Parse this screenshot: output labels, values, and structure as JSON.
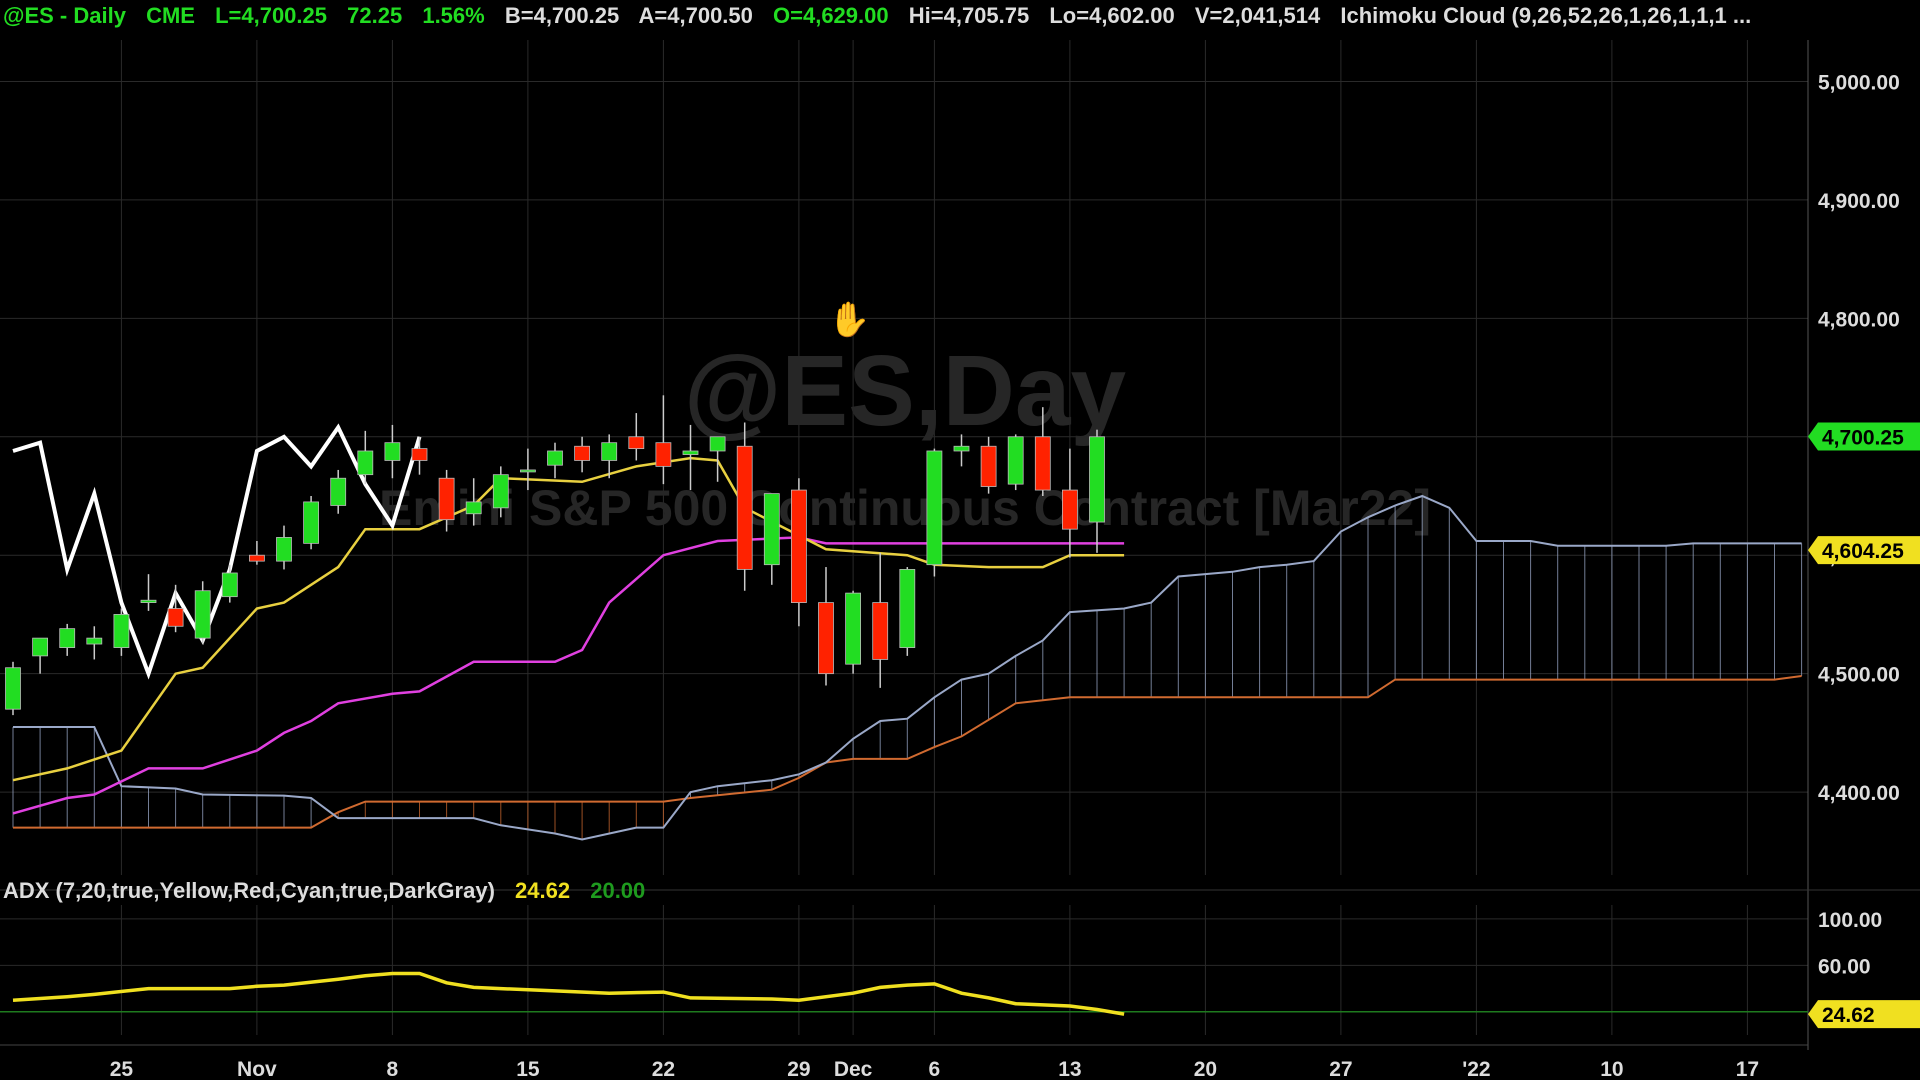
{
  "header": {
    "symbol": "@ES - Daily",
    "exchange": "CME",
    "last": "L=4,700.25",
    "change": "72.25",
    "change_pct": "1.56%",
    "bid": "B=4,700.25",
    "ask": "A=4,700.50",
    "open": "O=4,629.00",
    "high": "Hi=4,705.75",
    "low": "Lo=4,602.00",
    "volume": "V=2,041,514",
    "indicator": "Ichimoku Cloud (9,26,52,26,1,26,1,1,1 ..."
  },
  "watermark": {
    "line1": "@ES,Day",
    "line2": "Emini S&P 500 Continuous Contract [Mar22]"
  },
  "adx_header": {
    "label": "ADX (7,20,true,Yellow,Red,Cyan,true,DarkGray)",
    "value": "24.62",
    "threshold": "20.00"
  },
  "colors": {
    "up": "#22dd22",
    "down": "#ff2200",
    "tenkan": "#e8d040",
    "kijun": "#e040e0",
    "chikou": "#ffffff",
    "spanA": "#9aa8c8",
    "spanB": "#d06a30",
    "adx": "#f0e020",
    "grid": "#2a2a2a",
    "green_text": "#22dd22",
    "yellow": "#f0e020"
  },
  "chart_data": {
    "type": "candlestick",
    "y_axis": {
      "min": 4330,
      "max": 5035,
      "ticks": [
        4400,
        4500,
        4600,
        4700,
        4800,
        4900,
        5000
      ],
      "tick_labels": [
        "4,400.00",
        "4,500.00",
        "4,600.00",
        "4,700.00",
        "4,800.00",
        "4,900.00",
        "5,000.00"
      ]
    },
    "price_tags": [
      {
        "label": "4,700.25",
        "value": 4700.25,
        "color": "#22dd22"
      },
      {
        "label": "4,604.25",
        "value": 4604.25,
        "color": "#f0e020"
      }
    ],
    "x_axis": {
      "n": 67,
      "labels": [
        {
          "i": 4,
          "text": "25"
        },
        {
          "i": 9,
          "text": "Nov"
        },
        {
          "i": 14,
          "text": "8"
        },
        {
          "i": 19,
          "text": "15"
        },
        {
          "i": 24,
          "text": "22"
        },
        {
          "i": 29,
          "text": "29"
        },
        {
          "i": 31,
          "text": "Dec"
        },
        {
          "i": 34,
          "text": "6"
        },
        {
          "i": 39,
          "text": "13"
        },
        {
          "i": 44,
          "text": "20"
        },
        {
          "i": 49,
          "text": "27"
        },
        {
          "i": 54,
          "text": "'22"
        },
        {
          "i": 59,
          "text": "10"
        },
        {
          "i": 64,
          "text": "17"
        }
      ]
    },
    "candles": [
      {
        "o": 4470,
        "h": 4510,
        "l": 4465,
        "c": 4505
      },
      {
        "o": 4515,
        "h": 4530,
        "l": 4500,
        "c": 4530
      },
      {
        "o": 4522,
        "h": 4542,
        "l": 4515,
        "c": 4538
      },
      {
        "o": 4525,
        "h": 4540,
        "l": 4512,
        "c": 4530
      },
      {
        "o": 4522,
        "h": 4555,
        "l": 4515,
        "c": 4550
      },
      {
        "o": 4560,
        "h": 4584,
        "l": 4553,
        "c": 4562
      },
      {
        "o": 4555,
        "h": 4575,
        "l": 4535,
        "c": 4540
      },
      {
        "o": 4530,
        "h": 4578,
        "l": 4525,
        "c": 4570
      },
      {
        "o": 4565,
        "h": 4592,
        "l": 4560,
        "c": 4585
      },
      {
        "o": 4600,
        "h": 4612,
        "l": 4592,
        "c": 4595
      },
      {
        "o": 4595,
        "h": 4625,
        "l": 4588,
        "c": 4615
      },
      {
        "o": 4610,
        "h": 4650,
        "l": 4605,
        "c": 4645
      },
      {
        "o": 4642,
        "h": 4672,
        "l": 4635,
        "c": 4665
      },
      {
        "o": 4668,
        "h": 4705,
        "l": 4660,
        "c": 4688
      },
      {
        "o": 4680,
        "h": 4710,
        "l": 4665,
        "c": 4695
      },
      {
        "o": 4690,
        "h": 4700,
        "l": 4668,
        "c": 4680
      },
      {
        "o": 4665,
        "h": 4672,
        "l": 4620,
        "c": 4630
      },
      {
        "o": 4635,
        "h": 4665,
        "l": 4625,
        "c": 4645
      },
      {
        "o": 4640,
        "h": 4675,
        "l": 4632,
        "c": 4668
      },
      {
        "o": 4672,
        "h": 4690,
        "l": 4655,
        "c": 4672
      },
      {
        "o": 4676,
        "h": 4695,
        "l": 4665,
        "c": 4688
      },
      {
        "o": 4692,
        "h": 4700,
        "l": 4670,
        "c": 4680
      },
      {
        "o": 4680,
        "h": 4702,
        "l": 4665,
        "c": 4695
      },
      {
        "o": 4700,
        "h": 4720,
        "l": 4680,
        "c": 4690
      },
      {
        "o": 4695,
        "h": 4735,
        "l": 4660,
        "c": 4675
      },
      {
        "o": 4685,
        "h": 4710,
        "l": 4655,
        "c": 4688
      },
      {
        "o": 4688,
        "h": 4700,
        "l": 4662,
        "c": 4700
      },
      {
        "o": 4692,
        "h": 4712,
        "l": 4570,
        "c": 4588
      },
      {
        "o": 4592,
        "h": 4652,
        "l": 4575,
        "c": 4652
      },
      {
        "o": 4655,
        "h": 4665,
        "l": 4540,
        "c": 4560
      },
      {
        "o": 4560,
        "h": 4590,
        "l": 4490,
        "c": 4500
      },
      {
        "o": 4508,
        "h": 4570,
        "l": 4500,
        "c": 4568
      },
      {
        "o": 4560,
        "h": 4602,
        "l": 4488,
        "c": 4512
      },
      {
        "o": 4522,
        "h": 4590,
        "l": 4515,
        "c": 4588
      },
      {
        "o": 4592,
        "h": 4690,
        "l": 4582,
        "c": 4688
      },
      {
        "o": 4688,
        "h": 4702,
        "l": 4675,
        "c": 4692
      },
      {
        "o": 4692,
        "h": 4700,
        "l": 4652,
        "c": 4658
      },
      {
        "o": 4660,
        "h": 4702,
        "l": 4655,
        "c": 4700
      },
      {
        "o": 4700,
        "h": 4725,
        "l": 4650,
        "c": 4655
      },
      {
        "o": 4655,
        "h": 4690,
        "l": 4598,
        "c": 4622
      },
      {
        "o": 4628,
        "h": 4706,
        "l": 4602,
        "c": 4700
      }
    ],
    "tenkan": [
      [
        0,
        4410
      ],
      [
        2,
        4420
      ],
      [
        4,
        4435
      ],
      [
        6,
        4500
      ],
      [
        7,
        4505
      ],
      [
        9,
        4555
      ],
      [
        10,
        4560
      ],
      [
        11,
        4575
      ],
      [
        12,
        4590
      ],
      [
        13,
        4622
      ],
      [
        15,
        4622
      ],
      [
        17,
        4642
      ],
      [
        18,
        4665
      ],
      [
        21,
        4662
      ],
      [
        23,
        4675
      ],
      [
        25,
        4682
      ],
      [
        26,
        4680
      ],
      [
        27,
        4640
      ],
      [
        30,
        4605
      ],
      [
        33,
        4600
      ],
      [
        34,
        4592
      ],
      [
        36,
        4590
      ],
      [
        38,
        4590
      ],
      [
        39,
        4600
      ],
      [
        41,
        4600
      ]
    ],
    "kijun": [
      [
        0,
        4382
      ],
      [
        2,
        4395
      ],
      [
        3,
        4398
      ],
      [
        5,
        4420
      ],
      [
        7,
        4420
      ],
      [
        9,
        4435
      ],
      [
        10,
        4450
      ],
      [
        11,
        4460
      ],
      [
        12,
        4475
      ],
      [
        14,
        4483
      ],
      [
        15,
        4485
      ],
      [
        17,
        4510
      ],
      [
        20,
        4510
      ],
      [
        21,
        4520
      ],
      [
        22,
        4560
      ],
      [
        23,
        4580
      ],
      [
        24,
        4600
      ],
      [
        26,
        4612
      ],
      [
        29,
        4615
      ],
      [
        30,
        4610
      ],
      [
        41,
        4610
      ]
    ],
    "chikou": [
      [
        0,
        4688
      ],
      [
        1,
        4695
      ],
      [
        2,
        4588
      ],
      [
        3,
        4652
      ],
      [
        4,
        4560
      ],
      [
        5,
        4500
      ],
      [
        6,
        4568
      ],
      [
        7,
        4528
      ],
      [
        8,
        4588
      ],
      [
        9,
        4688
      ],
      [
        10,
        4700
      ],
      [
        11,
        4675
      ],
      [
        12,
        4708
      ],
      [
        13,
        4660
      ],
      [
        14,
        4625
      ],
      [
        15,
        4700
      ]
    ],
    "span_a": [
      [
        0,
        4455
      ],
      [
        3,
        4455
      ],
      [
        4,
        4405
      ],
      [
        6,
        4403
      ],
      [
        7,
        4398
      ],
      [
        10,
        4397
      ],
      [
        11,
        4395
      ],
      [
        12,
        4378
      ],
      [
        17,
        4378
      ],
      [
        18,
        4372
      ],
      [
        20,
        4365
      ],
      [
        21,
        4360
      ],
      [
        23,
        4370
      ],
      [
        24,
        4370
      ],
      [
        25,
        4400
      ],
      [
        26,
        4405
      ],
      [
        28,
        4410
      ],
      [
        29,
        4415
      ],
      [
        30,
        4425
      ],
      [
        31,
        4445
      ],
      [
        32,
        4460
      ],
      [
        33,
        4462
      ],
      [
        34,
        4480
      ],
      [
        35,
        4495
      ],
      [
        36,
        4500
      ],
      [
        37,
        4515
      ],
      [
        38,
        4528
      ],
      [
        39,
        4552
      ],
      [
        41,
        4555
      ],
      [
        42,
        4560
      ],
      [
        43,
        4582
      ],
      [
        45,
        4586
      ],
      [
        46,
        4590
      ],
      [
        47,
        4592
      ],
      [
        48,
        4595
      ],
      [
        49,
        4620
      ],
      [
        50,
        4632
      ],
      [
        51,
        4642
      ],
      [
        52,
        4650
      ],
      [
        53,
        4640
      ],
      [
        54,
        4612
      ],
      [
        56,
        4612
      ],
      [
        57,
        4608
      ],
      [
        61,
        4608
      ],
      [
        62,
        4610
      ],
      [
        66,
        4610
      ]
    ],
    "span_b": [
      [
        0,
        4370
      ],
      [
        11,
        4370
      ],
      [
        12,
        4383
      ],
      [
        13,
        4392
      ],
      [
        24,
        4392
      ],
      [
        25,
        4395
      ],
      [
        28,
        4402
      ],
      [
        29,
        4412
      ],
      [
        30,
        4425
      ],
      [
        31,
        4428
      ],
      [
        33,
        4428
      ],
      [
        34,
        4438
      ],
      [
        35,
        4447
      ],
      [
        37,
        4475
      ],
      [
        39,
        4480
      ],
      [
        50,
        4480
      ],
      [
        51,
        4495
      ],
      [
        65,
        4495
      ],
      [
        66,
        4498
      ]
    ],
    "adx": {
      "min": 0,
      "max": 112,
      "ticks": [
        60,
        100
      ],
      "tick_labels": [
        "60.00",
        "100.00"
      ],
      "threshold": 20,
      "last_label": "24.62",
      "points": [
        [
          0,
          30
        ],
        [
          2,
          33
        ],
        [
          3,
          35
        ],
        [
          5,
          40
        ],
        [
          6,
          40
        ],
        [
          8,
          40
        ],
        [
          9,
          42
        ],
        [
          10,
          43
        ],
        [
          12,
          48
        ],
        [
          13,
          51
        ],
        [
          14,
          53
        ],
        [
          15,
          53
        ],
        [
          16,
          45
        ],
        [
          17,
          41
        ],
        [
          18,
          40
        ],
        [
          20,
          38
        ],
        [
          22,
          36
        ],
        [
          24,
          37
        ],
        [
          25,
          32
        ],
        [
          28,
          31
        ],
        [
          29,
          30
        ],
        [
          31,
          36
        ],
        [
          32,
          41
        ],
        [
          33,
          43
        ],
        [
          34,
          44
        ],
        [
          35,
          36
        ],
        [
          36,
          32
        ],
        [
          37,
          27
        ],
        [
          39,
          25
        ],
        [
          40,
          22
        ],
        [
          41,
          18
        ]
      ]
    }
  }
}
